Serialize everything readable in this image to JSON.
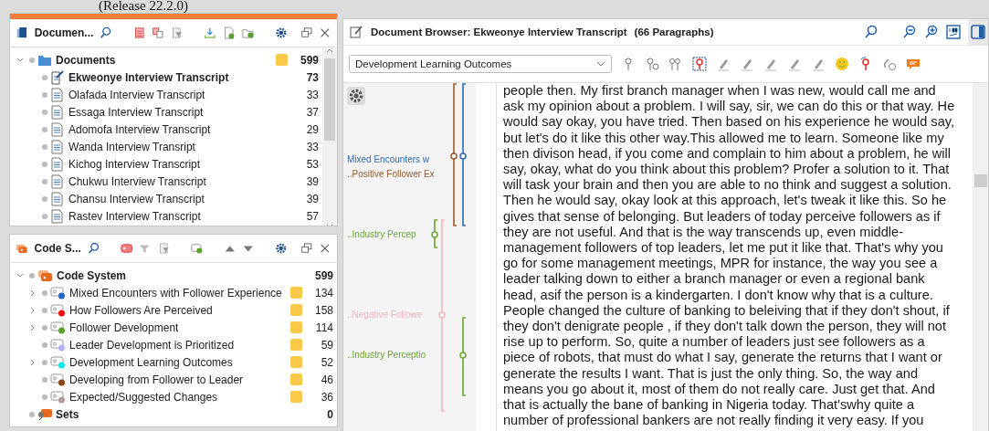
{
  "caption": "(Release 22.2.0)",
  "documents_panel": {
    "title": "Documen...",
    "root": {
      "label": "Documents",
      "expanded": true,
      "memo": true,
      "count": "599",
      "children": [
        {
          "label": "Ekweonye Interview Transcript",
          "count": "73",
          "selected": true
        },
        {
          "label": "Olafada Interview Transcript",
          "count": "33",
          "selected": false
        },
        {
          "label": "Essaga Interview Transcript",
          "count": "37",
          "selected": false
        },
        {
          "label": "Adomofa Interview Transcript",
          "count": "29",
          "selected": false
        },
        {
          "label": "Wanda Interview Transript",
          "count": "33",
          "selected": false
        },
        {
          "label": "Kichog Interview Transcript",
          "count": "53",
          "selected": false
        },
        {
          "label": "Chukwu Interview Transcript",
          "count": "39",
          "selected": false
        },
        {
          "label": "Chansu Interview Transcript",
          "count": "39",
          "selected": false
        },
        {
          "label": "Rastev Interview Transcript",
          "count": "57",
          "selected": false
        }
      ]
    }
  },
  "code_panel": {
    "title": "Code S...",
    "root": {
      "label": "Code System",
      "expanded": true,
      "count": "599",
      "children": [
        {
          "label": "Mixed Encounters with Follower Experience",
          "color": "#2166c4",
          "expandable": true,
          "memo": true,
          "count": "134"
        },
        {
          "label": "How Followers Are Perceived",
          "color": "#f01010",
          "expandable": true,
          "memo": true,
          "count": "158"
        },
        {
          "label": "Follower Development",
          "color": "#5aa02c",
          "expandable": true,
          "memo": true,
          "count": "114"
        },
        {
          "label": "Leader Development is Prioritized",
          "color": "#b4b4f5",
          "expandable": false,
          "memo": true,
          "count": "59"
        },
        {
          "label": "Development Learning Outcomes",
          "color": "#14e6f0",
          "expandable": true,
          "memo": true,
          "count": "52"
        },
        {
          "label": "Developing from Follower to Leader",
          "color": "#8b4513",
          "expandable": false,
          "memo": true,
          "count": "46"
        },
        {
          "label": "Expected/Suggested Changes",
          "color": "#b49a9a",
          "expandable": false,
          "memo": true,
          "count": "36"
        }
      ]
    },
    "sets": {
      "label": "Sets",
      "count": "0"
    }
  },
  "browser": {
    "title": "Document Browser: Ekweonye Interview Transcript",
    "paragraphs": "(66 Paragraphs)",
    "code_dropdown": "Development Learning Outcomes",
    "margin_codes": [
      {
        "label": "Mixed Encounters w",
        "color": "#2e6bb4"
      },
      {
        "label": "..Positive Follower Ex",
        "color": "#9a5a2c"
      },
      {
        "label": "..Industry Percep",
        "color": "#6aa533"
      },
      {
        "label": "..Negative Followe",
        "color": "#f0b4b9"
      },
      {
        "label": "..Industry Perceptio",
        "color": "#6aa533"
      }
    ],
    "text_lines": [
      "people then. My first branch manager when I was new, would call me and",
      "ask my opinion about a problem. I will say, sir, we can do this or that way. He",
      "would say okay, you have tried. Then based on his experience he would say,",
      "but let's do it like this other way.This allowed me to learn. Someone like my",
      "then divison head, if you  come and complain to him about a problem, he will",
      "say, okay, what do you think about this problem? Profer a solution to it. That",
      "will task your brain and then you are able to no think and suggest a solution.",
      "Then he would say, okay look at  this approach, let's tweak it like this. So he",
      "gives that sense of belonging. But leaders of today perceive followers as if",
      "they are not useful. And that is the way transcends up, even middle-",
      "management followers of top leaders, let me put it like that. That's why you",
      "go for some management meetings, MPR for instance, the way you see a",
      "leader talking down to either a branch manager or even a regional bank",
      "head, asif the person is a kindergarten. I don't know why that is a culture.",
      "People changed the culture of banking to beleiving that if they don't shout, if",
      "they don't denigrate people , if they don't talk down the person, they will not",
      "rise up to perform. So, quite a number of leaders just see followers as a",
      "piece of robots, that must do what I say, generate the returns that I want or",
      "generate the results I want. That is just the only thing. So, the way and",
      "means you go about it, most of them do not really care. Just get that. And",
      "that is actually the bane of banking in Nigeria today. That'swhy quite a",
      "number of professional bankers are not really finding it very easy. If you"
    ]
  }
}
